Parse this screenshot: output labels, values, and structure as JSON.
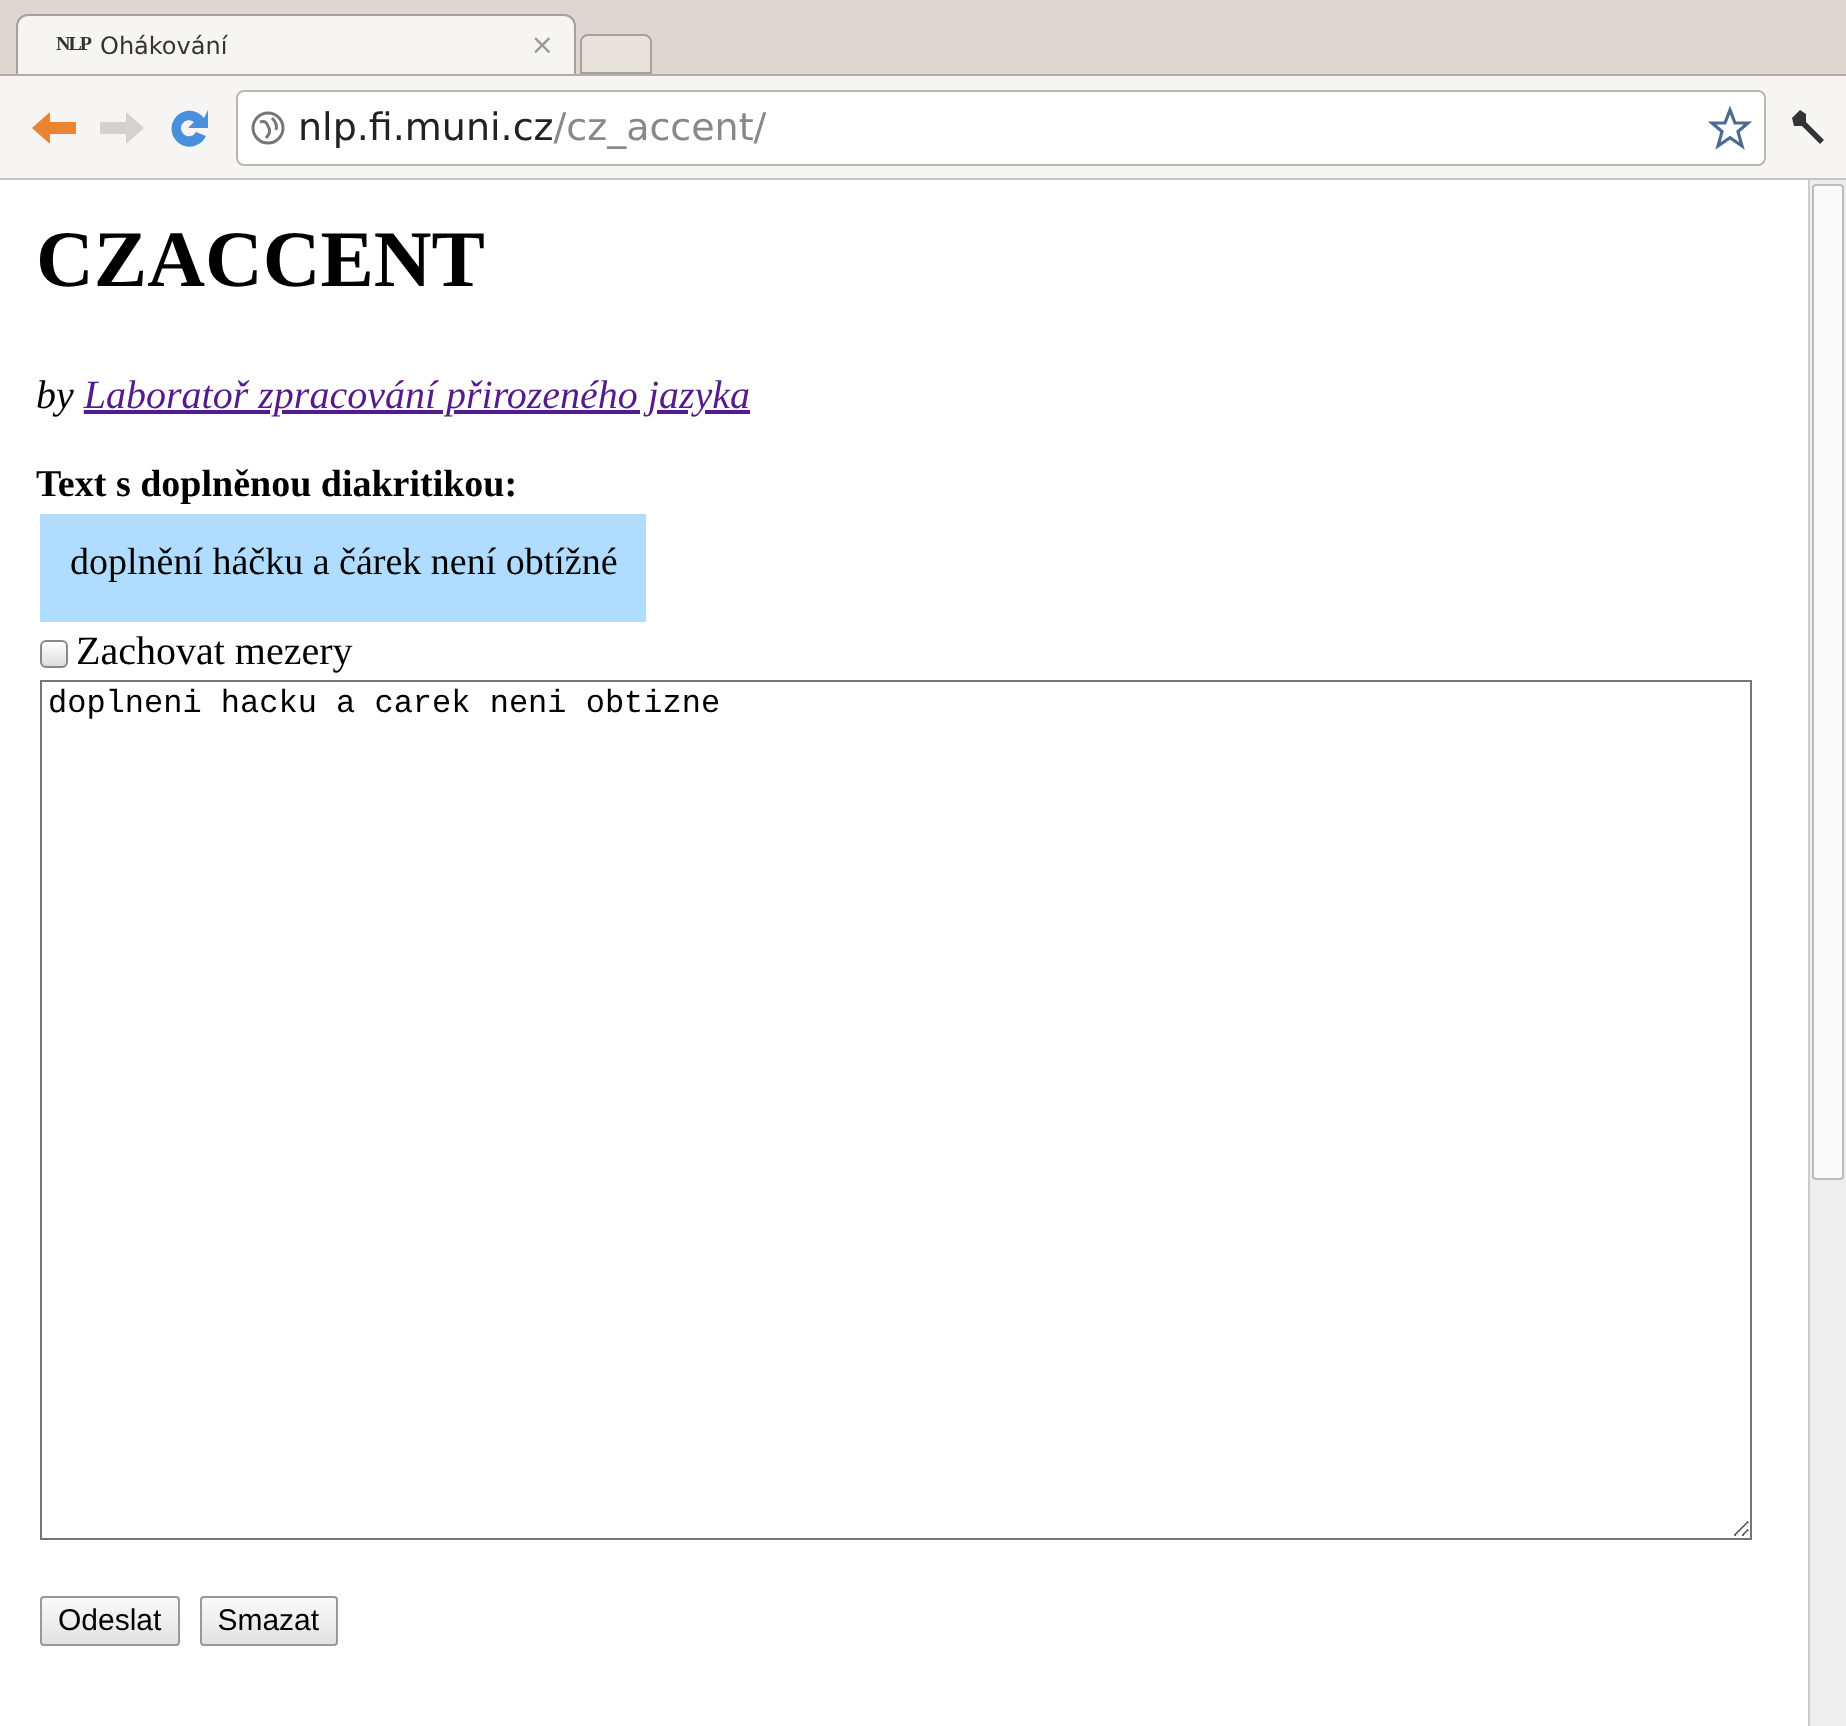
{
  "browser": {
    "tabs": [
      {
        "favicon": "NLP",
        "title": "Ohákování",
        "selected": true,
        "close": "×"
      }
    ],
    "address": {
      "host": "nlp.fi.muni.cz",
      "path": "/cz_accent/"
    }
  },
  "page": {
    "heading": "CZACCENT",
    "byline": {
      "prefix": "by",
      "link": "Laboratoř zpracování přirozeného jazyka"
    },
    "result_label": "Text s doplněnou diakritikou:",
    "result": "doplnění háčku a čárek není obtížné",
    "checkbox": {
      "label": "Zachovat mezery",
      "checked": false
    },
    "input": {
      "value": "doplneni hacku a carek neni obtizne"
    },
    "buttons": [
      "Odeslat",
      "Smazat"
    ]
  }
}
